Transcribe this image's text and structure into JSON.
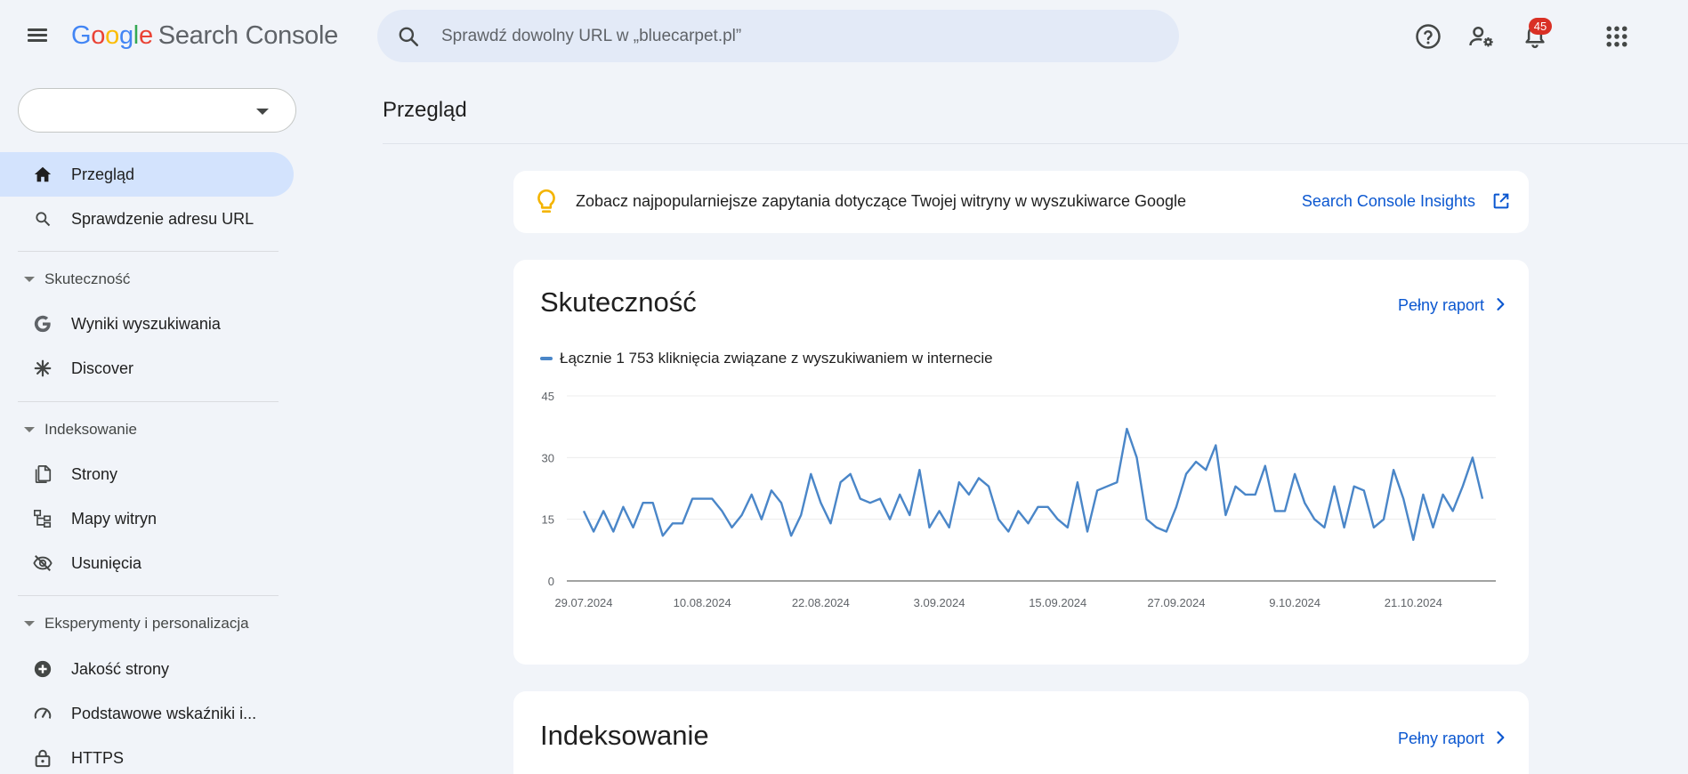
{
  "header": {
    "logo": {
      "g": "G",
      "o1": "o",
      "o2": "o",
      "g2": "g",
      "l": "l",
      "e": "e",
      "product": "Search Console"
    },
    "search_placeholder": "Sprawdź dowolny URL w „bluecarpet.pl”",
    "notifications_count": "45"
  },
  "sidebar": {
    "items": [
      {
        "label": "Przegląd",
        "icon": "home-icon",
        "active": true
      },
      {
        "label": "Sprawdzenie adresu URL",
        "icon": "search-icon"
      }
    ],
    "sections": [
      {
        "label": "Skuteczność",
        "items": [
          {
            "label": "Wyniki wyszukiwania",
            "icon": "google-g-icon"
          },
          {
            "label": "Discover",
            "icon": "asterisk-icon"
          }
        ]
      },
      {
        "label": "Indeksowanie",
        "items": [
          {
            "label": "Strony",
            "icon": "pages-icon"
          },
          {
            "label": "Mapy witryn",
            "icon": "sitemap-icon"
          },
          {
            "label": "Usunięcia",
            "icon": "eye-off-icon"
          }
        ]
      },
      {
        "label": "Eksperymenty i personalizacja",
        "items": [
          {
            "label": "Jakość strony",
            "icon": "plus-circle-icon"
          },
          {
            "label": "Podstawowe wskaźniki i...",
            "icon": "gauge-icon"
          },
          {
            "label": "HTTPS",
            "icon": "lock-icon"
          }
        ]
      }
    ]
  },
  "main": {
    "page_title": "Przegląd",
    "insight": {
      "text": "Zobacz najpopularniejsze zapytania dotyczące Twojej witryny w wyszukiwarce Google",
      "link": "Search Console Insights"
    },
    "performance": {
      "title": "Skuteczność",
      "full_report": "Pełny raport",
      "legend": "Łącznie 1 753 kliknięcia związane z wyszukiwaniem w internecie"
    },
    "indexing": {
      "title": "Indeksowanie",
      "full_report": "Pełny raport"
    }
  },
  "colors": {
    "accent": "#0b57d0",
    "series": "#4a86c8",
    "active_nav": "#d3e3fd",
    "badge": "#d93025"
  },
  "chart_data": {
    "type": "line",
    "title": "",
    "xlabel": "",
    "ylabel": "",
    "ylim": [
      0,
      45
    ],
    "yticks": [
      0,
      15,
      30,
      45
    ],
    "x_tick_labels": [
      "29.07.2024",
      "10.08.2024",
      "22.08.2024",
      "3.09.2024",
      "15.09.2024",
      "27.09.2024",
      "9.10.2024",
      "21.10.2024"
    ],
    "grid": true,
    "series": [
      {
        "name": "Łącznie 1 753 kliknięcia związane z wyszukiwaniem w internecie",
        "x_start": "2024-07-29",
        "values": [
          17,
          12,
          17,
          12,
          18,
          13,
          19,
          19,
          11,
          14,
          14,
          20,
          20,
          20,
          17,
          13,
          16,
          21,
          15,
          22,
          19,
          11,
          16,
          26,
          19,
          14,
          24,
          26,
          20,
          19,
          20,
          15,
          21,
          16,
          27,
          13,
          17,
          13,
          24,
          21,
          25,
          23,
          15,
          12,
          17,
          14,
          18,
          18,
          15,
          13,
          24,
          12,
          22,
          23,
          24,
          37,
          30,
          15,
          13,
          12,
          18,
          26,
          29,
          27,
          33,
          16,
          23,
          21,
          21,
          28,
          17,
          17,
          26,
          19,
          15,
          13,
          23,
          13,
          23,
          22,
          13,
          15,
          27,
          20,
          10,
          21,
          13,
          21,
          17,
          23,
          30,
          20
        ]
      }
    ]
  }
}
